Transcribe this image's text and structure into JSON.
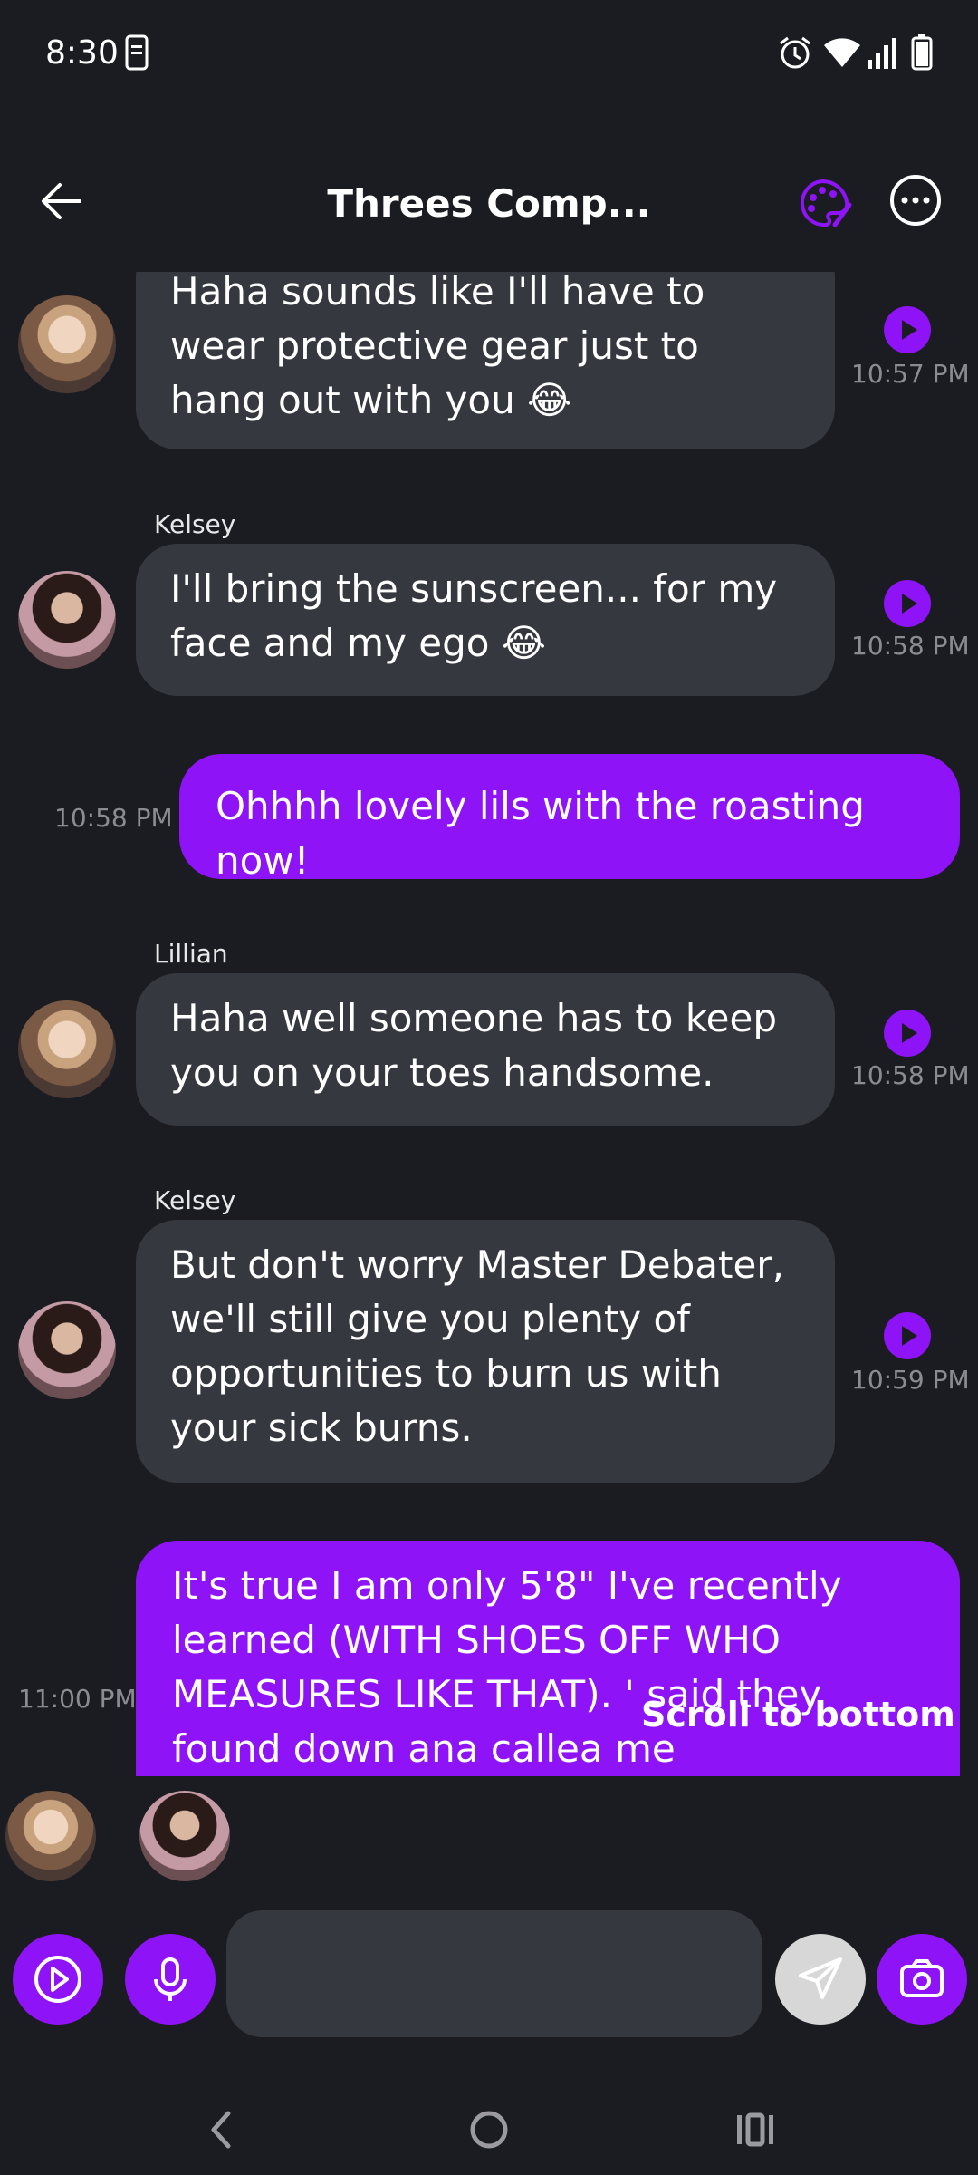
{
  "status": {
    "time": "8:30"
  },
  "header": {
    "title": "Threes Comp..."
  },
  "messages": [
    {
      "sender": "",
      "text": "Haha sounds like I'll have to wear protective gear just to hang out with you 😂",
      "time": "10:57 PM"
    },
    {
      "sender": "Kelsey",
      "text": "I'll bring the sunscreen... for my face and my ego 😂",
      "time": "10:58 PM"
    },
    {
      "sender": "",
      "text": "Ohhhh lovely lils with the roasting now!",
      "time": "10:58 PM"
    },
    {
      "sender": "Lillian",
      "text": "Haha well someone has to keep you on your toes handsome.",
      "time": "10:58 PM"
    },
    {
      "sender": "Kelsey",
      "text": "But don't worry Master Debater, we'll still give you plenty of opportunities to burn us with your sick burns.",
      "time": "10:59 PM"
    },
    {
      "sender": "",
      "text": "It's true I am only 5'8\" I've recently learned (WITH SHOES OFF WHO MEASURES LIKE THAT). ' said they found down ana callea me",
      "time": "11:00 PM"
    }
  ],
  "scroll_hint": "Scroll to bottom",
  "compose": {
    "placeholder": ""
  },
  "colors": {
    "accent": "#8e13f6",
    "background": "#1b1c21",
    "bubble_in": "#36383f"
  }
}
